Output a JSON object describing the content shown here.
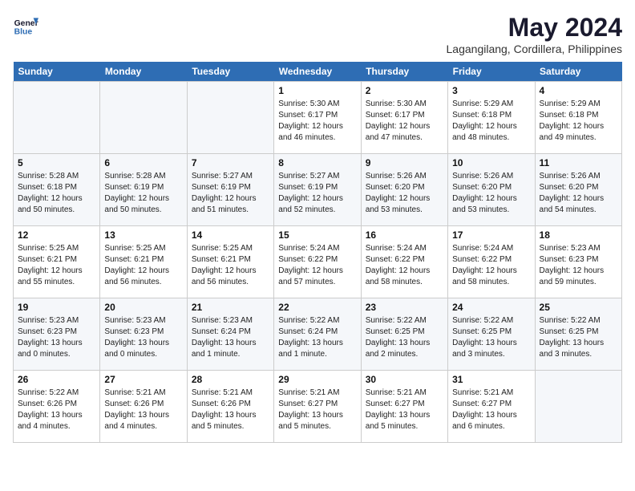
{
  "header": {
    "logo_line1": "General",
    "logo_line2": "Blue",
    "month": "May 2024",
    "location": "Lagangilang, Cordillera, Philippines"
  },
  "weekdays": [
    "Sunday",
    "Monday",
    "Tuesday",
    "Wednesday",
    "Thursday",
    "Friday",
    "Saturday"
  ],
  "weeks": [
    [
      {
        "day": "",
        "info": ""
      },
      {
        "day": "",
        "info": ""
      },
      {
        "day": "",
        "info": ""
      },
      {
        "day": "1",
        "info": "Sunrise: 5:30 AM\nSunset: 6:17 PM\nDaylight: 12 hours\nand 46 minutes."
      },
      {
        "day": "2",
        "info": "Sunrise: 5:30 AM\nSunset: 6:17 PM\nDaylight: 12 hours\nand 47 minutes."
      },
      {
        "day": "3",
        "info": "Sunrise: 5:29 AM\nSunset: 6:18 PM\nDaylight: 12 hours\nand 48 minutes."
      },
      {
        "day": "4",
        "info": "Sunrise: 5:29 AM\nSunset: 6:18 PM\nDaylight: 12 hours\nand 49 minutes."
      }
    ],
    [
      {
        "day": "5",
        "info": "Sunrise: 5:28 AM\nSunset: 6:18 PM\nDaylight: 12 hours\nand 50 minutes."
      },
      {
        "day": "6",
        "info": "Sunrise: 5:28 AM\nSunset: 6:19 PM\nDaylight: 12 hours\nand 50 minutes."
      },
      {
        "day": "7",
        "info": "Sunrise: 5:27 AM\nSunset: 6:19 PM\nDaylight: 12 hours\nand 51 minutes."
      },
      {
        "day": "8",
        "info": "Sunrise: 5:27 AM\nSunset: 6:19 PM\nDaylight: 12 hours\nand 52 minutes."
      },
      {
        "day": "9",
        "info": "Sunrise: 5:26 AM\nSunset: 6:20 PM\nDaylight: 12 hours\nand 53 minutes."
      },
      {
        "day": "10",
        "info": "Sunrise: 5:26 AM\nSunset: 6:20 PM\nDaylight: 12 hours\nand 53 minutes."
      },
      {
        "day": "11",
        "info": "Sunrise: 5:26 AM\nSunset: 6:20 PM\nDaylight: 12 hours\nand 54 minutes."
      }
    ],
    [
      {
        "day": "12",
        "info": "Sunrise: 5:25 AM\nSunset: 6:21 PM\nDaylight: 12 hours\nand 55 minutes."
      },
      {
        "day": "13",
        "info": "Sunrise: 5:25 AM\nSunset: 6:21 PM\nDaylight: 12 hours\nand 56 minutes."
      },
      {
        "day": "14",
        "info": "Sunrise: 5:25 AM\nSunset: 6:21 PM\nDaylight: 12 hours\nand 56 minutes."
      },
      {
        "day": "15",
        "info": "Sunrise: 5:24 AM\nSunset: 6:22 PM\nDaylight: 12 hours\nand 57 minutes."
      },
      {
        "day": "16",
        "info": "Sunrise: 5:24 AM\nSunset: 6:22 PM\nDaylight: 12 hours\nand 58 minutes."
      },
      {
        "day": "17",
        "info": "Sunrise: 5:24 AM\nSunset: 6:22 PM\nDaylight: 12 hours\nand 58 minutes."
      },
      {
        "day": "18",
        "info": "Sunrise: 5:23 AM\nSunset: 6:23 PM\nDaylight: 12 hours\nand 59 minutes."
      }
    ],
    [
      {
        "day": "19",
        "info": "Sunrise: 5:23 AM\nSunset: 6:23 PM\nDaylight: 13 hours\nand 0 minutes."
      },
      {
        "day": "20",
        "info": "Sunrise: 5:23 AM\nSunset: 6:23 PM\nDaylight: 13 hours\nand 0 minutes."
      },
      {
        "day": "21",
        "info": "Sunrise: 5:23 AM\nSunset: 6:24 PM\nDaylight: 13 hours\nand 1 minute."
      },
      {
        "day": "22",
        "info": "Sunrise: 5:22 AM\nSunset: 6:24 PM\nDaylight: 13 hours\nand 1 minute."
      },
      {
        "day": "23",
        "info": "Sunrise: 5:22 AM\nSunset: 6:25 PM\nDaylight: 13 hours\nand 2 minutes."
      },
      {
        "day": "24",
        "info": "Sunrise: 5:22 AM\nSunset: 6:25 PM\nDaylight: 13 hours\nand 3 minutes."
      },
      {
        "day": "25",
        "info": "Sunrise: 5:22 AM\nSunset: 6:25 PM\nDaylight: 13 hours\nand 3 minutes."
      }
    ],
    [
      {
        "day": "26",
        "info": "Sunrise: 5:22 AM\nSunset: 6:26 PM\nDaylight: 13 hours\nand 4 minutes."
      },
      {
        "day": "27",
        "info": "Sunrise: 5:21 AM\nSunset: 6:26 PM\nDaylight: 13 hours\nand 4 minutes."
      },
      {
        "day": "28",
        "info": "Sunrise: 5:21 AM\nSunset: 6:26 PM\nDaylight: 13 hours\nand 5 minutes."
      },
      {
        "day": "29",
        "info": "Sunrise: 5:21 AM\nSunset: 6:27 PM\nDaylight: 13 hours\nand 5 minutes."
      },
      {
        "day": "30",
        "info": "Sunrise: 5:21 AM\nSunset: 6:27 PM\nDaylight: 13 hours\nand 5 minutes."
      },
      {
        "day": "31",
        "info": "Sunrise: 5:21 AM\nSunset: 6:27 PM\nDaylight: 13 hours\nand 6 minutes."
      },
      {
        "day": "",
        "info": ""
      }
    ]
  ]
}
